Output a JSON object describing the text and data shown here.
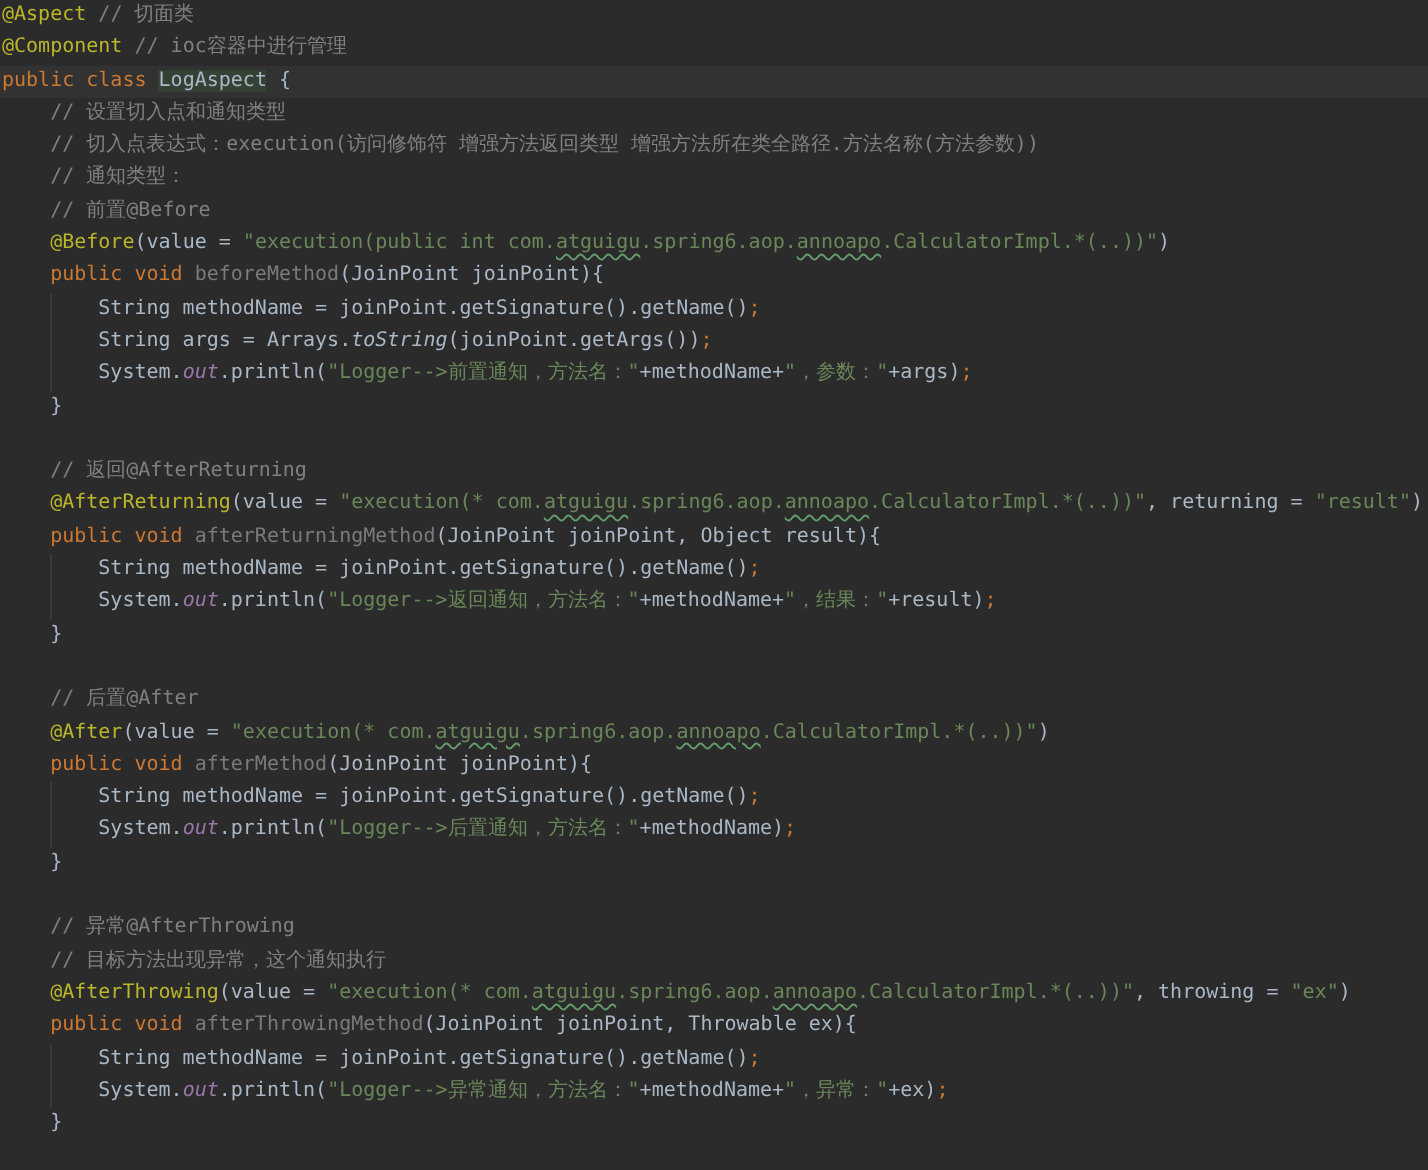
{
  "editor": {
    "lines": [
      {
        "kind": "code",
        "tokens": [
          {
            "text": "@Aspect",
            "kind": "annotation"
          },
          {
            "text": " // 切面类",
            "kind": "comment"
          }
        ]
      },
      {
        "kind": "code",
        "tokens": [
          {
            "text": "@Component",
            "kind": "annotation"
          },
          {
            "text": " // ioc容器中进行管理",
            "kind": "comment"
          }
        ]
      },
      {
        "kind": "code",
        "current": true,
        "tokens": [
          {
            "text": "public class ",
            "kind": "keyword"
          },
          {
            "text": "LogAspect",
            "kind": "highlight"
          },
          {
            "text": " {",
            "kind": "plain"
          }
        ]
      },
      {
        "kind": "code",
        "tokens": [
          {
            "text": "    // 设置切入点和通知类型",
            "kind": "comment"
          }
        ]
      },
      {
        "kind": "code",
        "tokens": [
          {
            "text": "    // 切入点表达式：execution(访问修饰符 增强方法返回类型 增强方法所在类全路径.方法名称(方法参数))",
            "kind": "comment"
          }
        ]
      },
      {
        "kind": "code",
        "tokens": [
          {
            "text": "    // 通知类型：",
            "kind": "comment"
          }
        ]
      },
      {
        "kind": "code",
        "tokens": [
          {
            "text": "    // 前置@Before",
            "kind": "comment"
          }
        ]
      },
      {
        "kind": "code",
        "tokens": [
          {
            "text": "    @Before",
            "kind": "annotation"
          },
          {
            "text": "(value = ",
            "kind": "plain"
          },
          {
            "text": "\"execution(public int com.",
            "kind": "string"
          },
          {
            "text": "atguigu",
            "kind": "typo"
          },
          {
            "text": ".spring6.aop.",
            "kind": "string"
          },
          {
            "text": "annoapo",
            "kind": "typo"
          },
          {
            "text": ".CalculatorImpl.*(..))\"",
            "kind": "string"
          },
          {
            "text": ")",
            "kind": "plain"
          }
        ]
      },
      {
        "kind": "code",
        "tokens": [
          {
            "text": "    public void ",
            "kind": "keyword"
          },
          {
            "text": "beforeMethod",
            "kind": "unused"
          },
          {
            "text": "(JoinPoint joinPoint){",
            "kind": "plain"
          }
        ]
      },
      {
        "kind": "code",
        "tokens": [
          {
            "text": "        String methodName = joinPoint.getSignature().getName()",
            "kind": "plain"
          },
          {
            "text": ";",
            "kind": "keyword"
          }
        ]
      },
      {
        "kind": "code",
        "tokens": [
          {
            "text": "        String args = Arrays.",
            "kind": "plain"
          },
          {
            "text": "toString",
            "kind": "static"
          },
          {
            "text": "(joinPoint.getArgs())",
            "kind": "plain"
          },
          {
            "text": ";",
            "kind": "keyword"
          }
        ]
      },
      {
        "kind": "code",
        "tokens": [
          {
            "text": "        System.",
            "kind": "plain"
          },
          {
            "text": "out",
            "kind": "field"
          },
          {
            "text": ".println(",
            "kind": "plain"
          },
          {
            "text": "\"Logger-->前置通知，方法名：\"",
            "kind": "string"
          },
          {
            "text": "+methodName+",
            "kind": "plain"
          },
          {
            "text": "\"，参数：\"",
            "kind": "string"
          },
          {
            "text": "+args)",
            "kind": "plain"
          },
          {
            "text": ";",
            "kind": "keyword"
          }
        ]
      },
      {
        "kind": "code",
        "tokens": [
          {
            "text": "    }",
            "kind": "plain"
          }
        ]
      },
      {
        "kind": "blank"
      },
      {
        "kind": "code",
        "tokens": [
          {
            "text": "    // 返回@AfterReturning",
            "kind": "comment"
          }
        ]
      },
      {
        "kind": "code",
        "tokens": [
          {
            "text": "    @AfterReturning",
            "kind": "annotation"
          },
          {
            "text": "(value = ",
            "kind": "plain"
          },
          {
            "text": "\"execution(* com.",
            "kind": "string"
          },
          {
            "text": "atguigu",
            "kind": "typo"
          },
          {
            "text": ".spring6.aop.",
            "kind": "string"
          },
          {
            "text": "annoapo",
            "kind": "typo"
          },
          {
            "text": ".CalculatorImpl.*(..))\"",
            "kind": "string"
          },
          {
            "text": ", returning = ",
            "kind": "plain"
          },
          {
            "text": "\"result\"",
            "kind": "string"
          },
          {
            "text": ")",
            "kind": "plain"
          }
        ]
      },
      {
        "kind": "code",
        "tokens": [
          {
            "text": "    public void ",
            "kind": "keyword"
          },
          {
            "text": "afterReturningMethod",
            "kind": "unused"
          },
          {
            "text": "(JoinPoint joinPoint, Object result){",
            "kind": "plain"
          }
        ]
      },
      {
        "kind": "code",
        "tokens": [
          {
            "text": "        String methodName = joinPoint.getSignature().getName()",
            "kind": "plain"
          },
          {
            "text": ";",
            "kind": "keyword"
          }
        ]
      },
      {
        "kind": "code",
        "tokens": [
          {
            "text": "        System.",
            "kind": "plain"
          },
          {
            "text": "out",
            "kind": "field"
          },
          {
            "text": ".println(",
            "kind": "plain"
          },
          {
            "text": "\"Logger-->返回通知，方法名：\"",
            "kind": "string"
          },
          {
            "text": "+methodName+",
            "kind": "plain"
          },
          {
            "text": "\"，结果：\"",
            "kind": "string"
          },
          {
            "text": "+result)",
            "kind": "plain"
          },
          {
            "text": ";",
            "kind": "keyword"
          }
        ]
      },
      {
        "kind": "code",
        "tokens": [
          {
            "text": "    }",
            "kind": "plain"
          }
        ]
      },
      {
        "kind": "blank"
      },
      {
        "kind": "code",
        "tokens": [
          {
            "text": "    // 后置@After",
            "kind": "comment"
          }
        ]
      },
      {
        "kind": "code",
        "tokens": [
          {
            "text": "    @After",
            "kind": "annotation"
          },
          {
            "text": "(value = ",
            "kind": "plain"
          },
          {
            "text": "\"execution(* com.",
            "kind": "string"
          },
          {
            "text": "atguigu",
            "kind": "typo"
          },
          {
            "text": ".spring6.aop.",
            "kind": "string"
          },
          {
            "text": "annoapo",
            "kind": "typo"
          },
          {
            "text": ".CalculatorImpl.*(..))\"",
            "kind": "string"
          },
          {
            "text": ")",
            "kind": "plain"
          }
        ]
      },
      {
        "kind": "code",
        "tokens": [
          {
            "text": "    public void ",
            "kind": "keyword"
          },
          {
            "text": "afterMethod",
            "kind": "unused"
          },
          {
            "text": "(JoinPoint joinPoint){",
            "kind": "plain"
          }
        ]
      },
      {
        "kind": "code",
        "tokens": [
          {
            "text": "        String methodName = joinPoint.getSignature().getName()",
            "kind": "plain"
          },
          {
            "text": ";",
            "kind": "keyword"
          }
        ]
      },
      {
        "kind": "code",
        "tokens": [
          {
            "text": "        System.",
            "kind": "plain"
          },
          {
            "text": "out",
            "kind": "field"
          },
          {
            "text": ".println(",
            "kind": "plain"
          },
          {
            "text": "\"Logger-->后置通知，方法名：\"",
            "kind": "string"
          },
          {
            "text": "+methodName)",
            "kind": "plain"
          },
          {
            "text": ";",
            "kind": "keyword"
          }
        ]
      },
      {
        "kind": "code",
        "tokens": [
          {
            "text": "    }",
            "kind": "plain"
          }
        ]
      },
      {
        "kind": "blank"
      },
      {
        "kind": "code",
        "tokens": [
          {
            "text": "    // 异常@AfterThrowing",
            "kind": "comment"
          }
        ]
      },
      {
        "kind": "code",
        "tokens": [
          {
            "text": "    // 目标方法出现异常，这个通知执行",
            "kind": "comment"
          }
        ]
      },
      {
        "kind": "code",
        "tokens": [
          {
            "text": "    @AfterThrowing",
            "kind": "annotation"
          },
          {
            "text": "(value = ",
            "kind": "plain"
          },
          {
            "text": "\"execution(* com.",
            "kind": "string"
          },
          {
            "text": "atguigu",
            "kind": "typo"
          },
          {
            "text": ".spring6.aop.",
            "kind": "string"
          },
          {
            "text": "annoapo",
            "kind": "typo"
          },
          {
            "text": ".CalculatorImpl.*(..))\"",
            "kind": "string"
          },
          {
            "text": ", throwing = ",
            "kind": "plain"
          },
          {
            "text": "\"ex\"",
            "kind": "string"
          },
          {
            "text": ")",
            "kind": "plain"
          }
        ]
      },
      {
        "kind": "code",
        "tokens": [
          {
            "text": "    public void ",
            "kind": "keyword"
          },
          {
            "text": "afterThrowingMethod",
            "kind": "unused"
          },
          {
            "text": "(JoinPoint joinPoint, Throwable ex){",
            "kind": "plain"
          }
        ]
      },
      {
        "kind": "code",
        "tokens": [
          {
            "text": "        String methodName = joinPoint.getSignature().getName()",
            "kind": "plain"
          },
          {
            "text": ";",
            "kind": "keyword"
          }
        ]
      },
      {
        "kind": "code",
        "tokens": [
          {
            "text": "        System.",
            "kind": "plain"
          },
          {
            "text": "out",
            "kind": "field"
          },
          {
            "text": ".println(",
            "kind": "plain"
          },
          {
            "text": "\"Logger-->异常通知，方法名：\"",
            "kind": "string"
          },
          {
            "text": "+methodName+",
            "kind": "plain"
          },
          {
            "text": "\"，异常：\"",
            "kind": "string"
          },
          {
            "text": "+ex)",
            "kind": "plain"
          },
          {
            "text": ";",
            "kind": "keyword"
          }
        ]
      },
      {
        "kind": "code",
        "tokens": [
          {
            "text": "    }",
            "kind": "plain"
          }
        ]
      }
    ]
  }
}
